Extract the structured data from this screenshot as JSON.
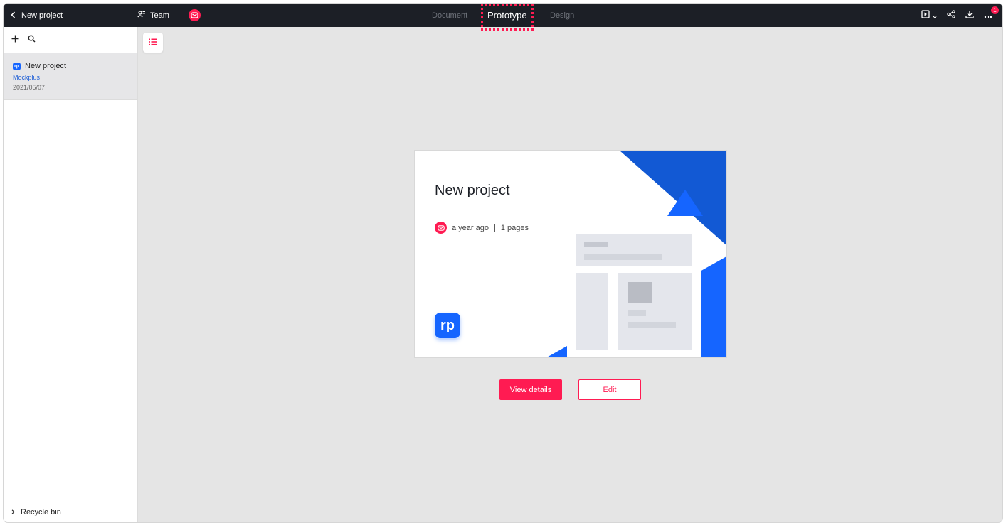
{
  "topbar": {
    "back_label": "New project",
    "team_label": "Team",
    "tabs": [
      {
        "label": "Document"
      },
      {
        "label": "Prototype",
        "active": true
      },
      {
        "label": "Design"
      }
    ],
    "notification_count": "1"
  },
  "sidebar": {
    "project": {
      "icon_text": "rp",
      "name": "New project",
      "team": "Mockplus",
      "date": "2021/05/07"
    },
    "recycle_label": "Recycle bin"
  },
  "card": {
    "title": "New project",
    "time": "a year ago",
    "separator": "|",
    "pages": "1 pages",
    "logo_text": "rp"
  },
  "actions": {
    "view_details": "View details",
    "edit": "Edit"
  },
  "colors": {
    "accent": "#ff1b52",
    "brand_blue": "#1565ff",
    "topbar_bg": "#1c1f26"
  }
}
